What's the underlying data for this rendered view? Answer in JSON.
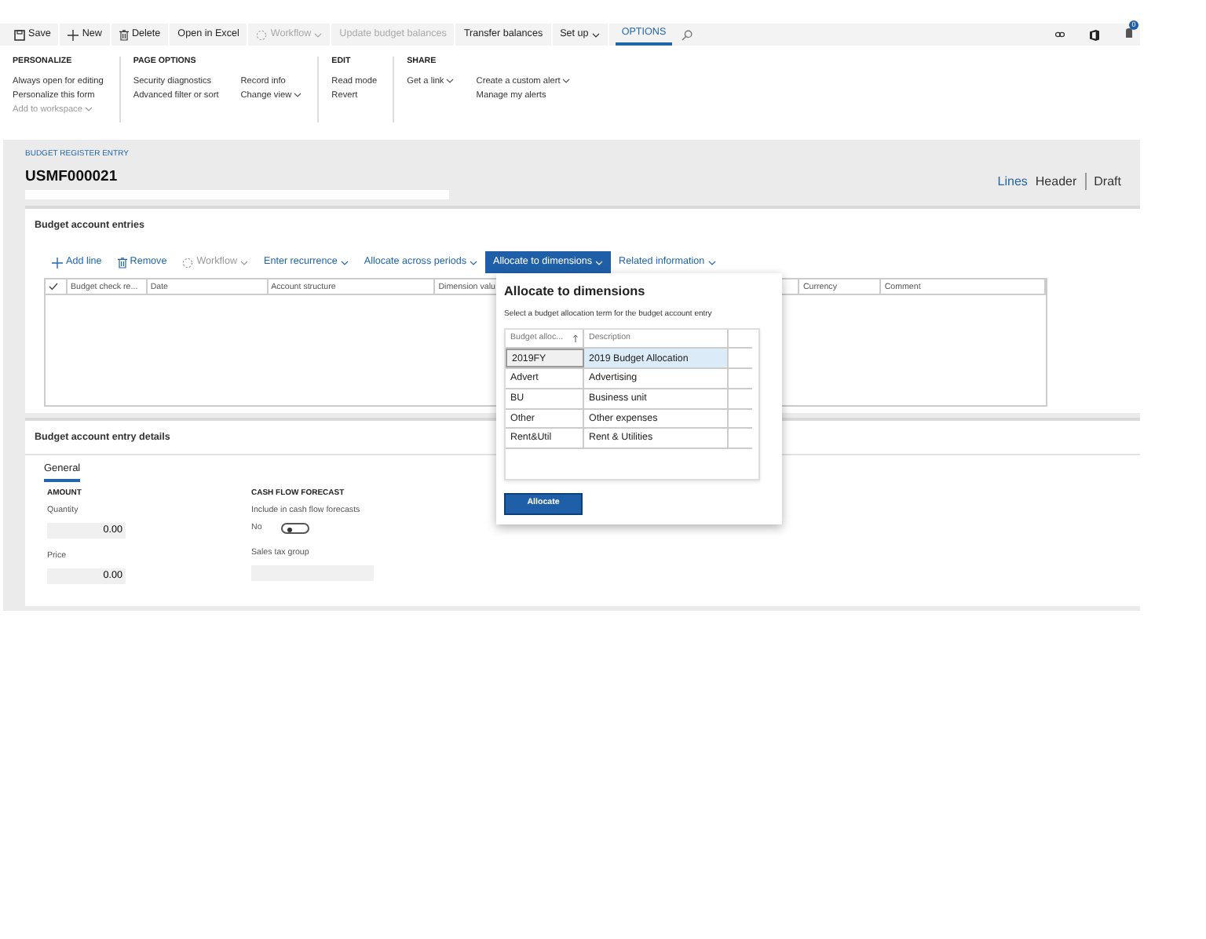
{
  "toolbar": {
    "buttons": [
      {
        "label": "Save",
        "disabled": false,
        "has_menu": false
      },
      {
        "label": "New",
        "disabled": false,
        "has_menu": false
      },
      {
        "label": "Delete",
        "disabled": false,
        "has_menu": false
      },
      {
        "label": "Open in Excel",
        "disabled": false,
        "has_menu": false
      },
      {
        "label": "Workflow",
        "disabled": true,
        "has_menu": true
      },
      {
        "label": "Update budget balances",
        "disabled": true,
        "has_menu": false
      },
      {
        "label": "Transfer balances",
        "disabled": false,
        "has_menu": false
      },
      {
        "label": "Set up",
        "disabled": false,
        "has_menu": true
      }
    ],
    "tabs": [
      {
        "label": "OPTIONS",
        "selected": true
      }
    ],
    "notification_count": "0"
  },
  "ribbon": {
    "groups": [
      {
        "title": "PERSONALIZE",
        "columns": [
          [
            {
              "label": "Always open for editing",
              "disabled": false,
              "has_menu": false
            },
            {
              "label": "Personalize this form",
              "disabled": false,
              "has_menu": false
            },
            {
              "label": "Add to workspace",
              "disabled": true,
              "has_menu": true
            }
          ]
        ]
      },
      {
        "title": "PAGE OPTIONS",
        "columns": [
          [
            {
              "label": "Security diagnostics",
              "disabled": false,
              "has_menu": false
            },
            {
              "label": "Advanced filter or sort",
              "disabled": false,
              "has_menu": false
            }
          ],
          [
            {
              "label": "Record info",
              "disabled": false,
              "has_menu": false
            },
            {
              "label": "Change view",
              "disabled": false,
              "has_menu": true
            }
          ]
        ]
      },
      {
        "title": "EDIT",
        "columns": [
          [
            {
              "label": "Read mode",
              "disabled": false,
              "has_menu": false
            },
            {
              "label": "Revert",
              "disabled": false,
              "has_menu": false
            }
          ]
        ]
      },
      {
        "title": "SHARE",
        "columns": [
          [
            {
              "label": "Get a link",
              "disabled": false,
              "has_menu": true
            }
          ],
          [
            {
              "label": "Create a custom alert",
              "disabled": false,
              "has_menu": true
            },
            {
              "label": "Manage my alerts",
              "disabled": false,
              "has_menu": false
            }
          ]
        ]
      }
    ]
  },
  "page": {
    "caption": "BUDGET REGISTER ENTRY",
    "title": "USMF000021",
    "views": [
      {
        "label": "Lines",
        "selected": true
      },
      {
        "label": "Header",
        "selected": false
      }
    ],
    "status": "Draft"
  },
  "entries": {
    "title": "Budget account entries",
    "actions": [
      {
        "label": "Add line",
        "disabled": false,
        "has_menu": false,
        "expanded": false
      },
      {
        "label": "Remove",
        "disabled": false,
        "has_menu": false,
        "expanded": false
      },
      {
        "label": "Workflow",
        "disabled": true,
        "has_menu": true,
        "expanded": false
      },
      {
        "label": "Enter recurrence",
        "disabled": false,
        "has_menu": true,
        "expanded": false
      },
      {
        "label": "Allocate across periods",
        "disabled": false,
        "has_menu": true,
        "expanded": false
      },
      {
        "label": "Allocate to dimensions",
        "disabled": false,
        "has_menu": true,
        "expanded": true
      },
      {
        "label": "Related information",
        "disabled": false,
        "has_menu": true,
        "expanded": false
      }
    ],
    "columns": [
      "Budget check re...",
      "Date",
      "Account structure",
      "Dimension valu",
      "Currency",
      "Comment"
    ]
  },
  "popup": {
    "title": "Allocate to dimensions",
    "subtitle": "Select a budget allocation term for the budget account entry",
    "columns": [
      {
        "label": "Budget alloc...",
        "sorted": true
      },
      {
        "label": "Description",
        "sorted": false
      }
    ],
    "rows": [
      {
        "cells": [
          "2019FY",
          "2019 Budget Allocation"
        ],
        "selected": true
      },
      {
        "cells": [
          "Advert",
          "Advertising"
        ],
        "selected": false
      },
      {
        "cells": [
          "BU",
          "Business unit"
        ],
        "selected": false
      },
      {
        "cells": [
          "Other",
          "Other expenses"
        ],
        "selected": false
      },
      {
        "cells": [
          "Rent&Util",
          "Rent & Utilities"
        ],
        "selected": false
      }
    ],
    "button": "Allocate"
  },
  "details": {
    "title": "Budget account entry details",
    "tabs": [
      {
        "label": "General",
        "selected": true
      }
    ],
    "groups": [
      {
        "title": "AMOUNT",
        "fields": [
          {
            "kind": "number",
            "label": "Quantity",
            "value": "0.00"
          },
          {
            "kind": "number",
            "label": "Price",
            "value": "0.00"
          }
        ]
      },
      {
        "title": "CASH FLOW FORECAST",
        "fields": [
          {
            "kind": "toggle",
            "label": "Include in cash flow forecasts",
            "value_text": "No",
            "on": false
          },
          {
            "kind": "text",
            "label": "Sales tax group"
          }
        ]
      }
    ]
  }
}
